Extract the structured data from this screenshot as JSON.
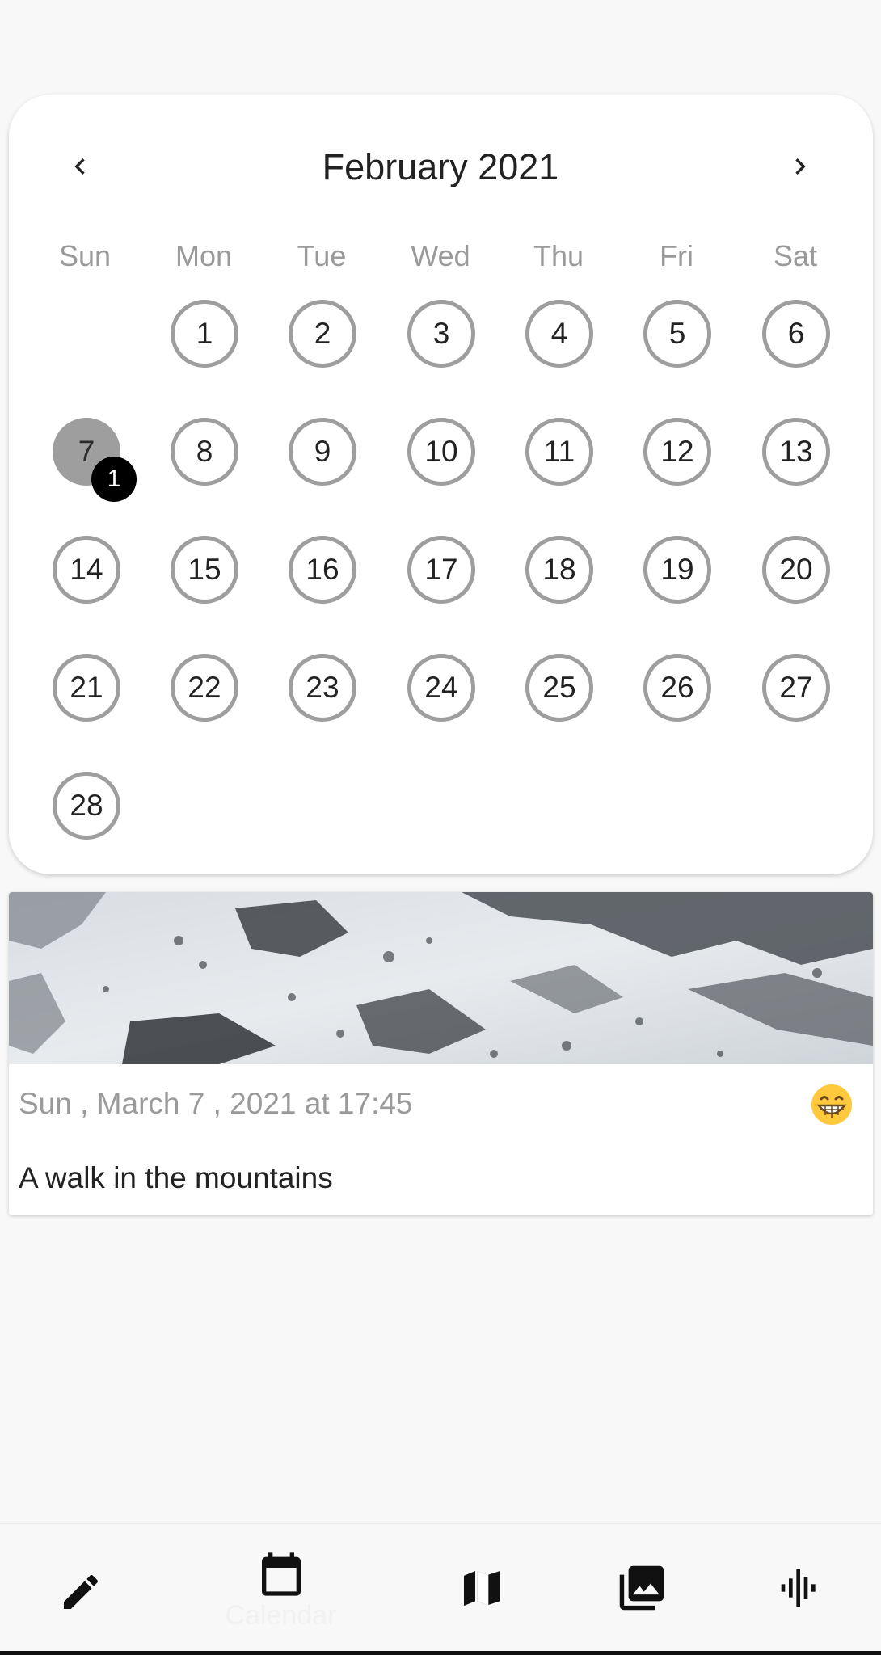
{
  "calendar": {
    "month_title": "February 2021",
    "prev_icon": "chevron-left-icon",
    "next_icon": "chevron-right-icon",
    "weekdays": [
      "Sun",
      "Mon",
      "Tue",
      "Wed",
      "Thu",
      "Fri",
      "Sat"
    ],
    "days": [
      "1",
      "2",
      "3",
      "4",
      "5",
      "6",
      "7",
      "8",
      "9",
      "10",
      "11",
      "12",
      "13",
      "14",
      "15",
      "16",
      "17",
      "18",
      "19",
      "20",
      "21",
      "22",
      "23",
      "24",
      "25",
      "26",
      "27",
      "28"
    ],
    "selected_day": "7",
    "selected_badge": "1",
    "colors": {
      "ring": "#9e9e9e",
      "selected_fill": "#9e9e9e",
      "badge": "#000000"
    }
  },
  "entry": {
    "date_text": "Sun , March 7 , 2021 at 17:45",
    "title": "A walk in the mountains",
    "mood_icon": "grinning-face-emoji-icon",
    "image": "snowy-mountain-photo"
  },
  "bottom_nav": {
    "items": [
      {
        "icon": "pencil-icon"
      },
      {
        "icon": "calendar-icon",
        "label": "Calendar"
      },
      {
        "icon": "map-icon"
      },
      {
        "icon": "photo-library-icon"
      },
      {
        "icon": "audio-waveform-icon"
      }
    ]
  }
}
